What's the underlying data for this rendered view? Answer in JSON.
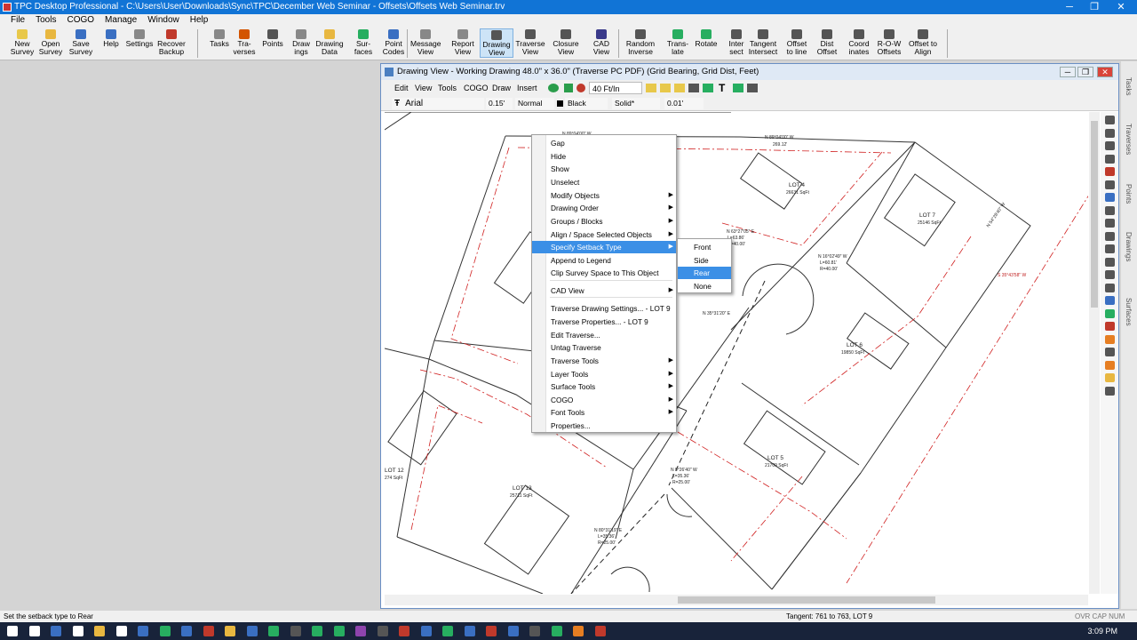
{
  "window": {
    "title": "TPC Desktop Professional - C:\\Users\\User\\Downloads\\Sync\\TPC\\December Web Seminar - Offsets\\Offsets Web Seminar.trv"
  },
  "menu": [
    "File",
    "Tools",
    "COGO",
    "Manage",
    "Window",
    "Help"
  ],
  "toolbar": [
    {
      "l1": "New",
      "l2": "Survey",
      "color": "#e8c84a"
    },
    {
      "l1": "Open",
      "l2": "Survey",
      "color": "#e8b740"
    },
    {
      "l1": "Save",
      "l2": "Survey",
      "color": "#3a6fc2"
    },
    {
      "l1": "Help",
      "l2": "",
      "color": "#3a6fc2"
    },
    {
      "l1": "Settings",
      "l2": "",
      "color": "#888888"
    },
    {
      "l1": "Recover",
      "l2": "Backup",
      "color": "#c0392b"
    },
    {
      "l1": "Tasks",
      "l2": "",
      "color": "#888888"
    },
    {
      "l1": "Tra-",
      "l2": "verses",
      "color": "#d35400"
    },
    {
      "l1": "Points",
      "l2": "",
      "color": "#555555"
    },
    {
      "l1": "Draw",
      "l2": "ings",
      "color": "#888888"
    },
    {
      "l1": "Drawing",
      "l2": "Data",
      "color": "#e8b740"
    },
    {
      "l1": "Sur-",
      "l2": "faces",
      "color": "#27ae60"
    },
    {
      "l1": "Point",
      "l2": "Codes",
      "color": "#3a6fc2"
    },
    {
      "l1": "Message",
      "l2": "View",
      "color": "#888888"
    },
    {
      "l1": "Report",
      "l2": "View",
      "color": "#888888"
    },
    {
      "l1": "Drawing",
      "l2": "View",
      "color": "#555555"
    },
    {
      "l1": "Traverse",
      "l2": "View",
      "color": "#555555"
    },
    {
      "l1": "Closure",
      "l2": "View",
      "color": "#555555"
    },
    {
      "l1": "CAD",
      "l2": "View",
      "color": "#3a3a8a"
    },
    {
      "l1": "Random",
      "l2": "Inverse",
      "color": "#555555"
    },
    {
      "l1": "Trans-",
      "l2": "late",
      "color": "#27ae60"
    },
    {
      "l1": "Rotate",
      "l2": "",
      "color": "#27ae60"
    },
    {
      "l1": "Inter",
      "l2": "sect",
      "color": "#555555"
    },
    {
      "l1": "Tangent",
      "l2": "Intersect",
      "color": "#555555"
    },
    {
      "l1": "Offset",
      "l2": "to line",
      "color": "#555555"
    },
    {
      "l1": "Dist",
      "l2": "Offset",
      "color": "#555555"
    },
    {
      "l1": "Coord",
      "l2": "inates",
      "color": "#555555"
    },
    {
      "l1": "R-O-W",
      "l2": "Offsets",
      "color": "#555555"
    },
    {
      "l1": "Offset to",
      "l2": "Align",
      "color": "#555555"
    }
  ],
  "drawing_window": {
    "title": "Drawing View - Working Drawing  48.0\" x 36.0\" (Traverse PC PDF) (Grid Bearing, Grid Dist, Feet)",
    "menu": [
      "Edit",
      "View",
      "Tools",
      "COGO",
      "Draw",
      "Insert"
    ],
    "scale": "40 Ft/In",
    "font": "Arial",
    "size": "0.15'",
    "style": "Normal",
    "color": "Black",
    "line": "Solid*",
    "weight": "0.01'"
  },
  "context_menu": [
    {
      "label": "Gap"
    },
    {
      "label": "Hide"
    },
    {
      "label": "Show"
    },
    {
      "label": "Unselect"
    },
    {
      "label": "Modify Objects",
      "sub": true
    },
    {
      "label": "Drawing Order",
      "sub": true
    },
    {
      "label": "Groups / Blocks",
      "sub": true
    },
    {
      "label": "Align / Space Selected Objects",
      "sub": true
    },
    {
      "label": "Specify Setback Type",
      "sub": true,
      "hl": true
    },
    {
      "label": "Append to Legend"
    },
    {
      "label": "Clip Survey Space to This Object"
    },
    {
      "label": "CAD View",
      "sub": true
    },
    {
      "label": "Traverse Drawing Settings... - LOT 9"
    },
    {
      "label": "Traverse Properties... - LOT 9"
    },
    {
      "label": "Edit Traverse..."
    },
    {
      "label": "Untag Traverse"
    },
    {
      "label": "Traverse Tools",
      "sub": true
    },
    {
      "label": "Layer Tools",
      "sub": true
    },
    {
      "label": "Surface Tools",
      "sub": true
    },
    {
      "label": "COGO",
      "sub": true
    },
    {
      "label": "Font Tools",
      "sub": true
    },
    {
      "label": "Properties..."
    }
  ],
  "submenu": [
    "Front",
    "Side",
    "Rear",
    "None"
  ],
  "submenu_selected": "Rear",
  "drawing_labels": {
    "lot4": "LOT 4",
    "lot4_area": "26631 SqFt",
    "lot7": "LOT 7",
    "lot7_area": "25146 SqFt",
    "lot6": "LOT 6",
    "lot6_area": "19850 SqFt",
    "lot5": "LOT 5",
    "lot5_area": "21709 SqFt",
    "lot13": "LOT 13",
    "lot13_area": "25711 SqFt",
    "lot12": "LOT 12",
    "lot12_area": "274 SqFt",
    "b1": "N 89°04'00\" W",
    "b2": "N 89°04'00\" W",
    "b3": "269.12'",
    "c1": "N 63°27'05\" E",
    "c2": "L=63.86'",
    "c3": "R=40.00'",
    "c4": "N 16°02'49\" W",
    "c5": "L=60.81'",
    "c6": "R=40.00'",
    "c7": "N 9°26'40\" W",
    "c8": "L=35.36'",
    "c9": "R=25.00'",
    "c10": "N 80°31'19\" E",
    "c11": "L=35.36'",
    "c12": "R=25.00'",
    "d1": "S 35°43'58\" W",
    "d2": "N 35°31'20\" E",
    "d3": "N 54°28'40\" W"
  },
  "status": {
    "left": "Set the setback type to Rear",
    "middle": "Tangent: 761 to 763, LOT 9",
    "right": "OVR CAP NUM"
  },
  "right_tabs": [
    "Tasks",
    "Traverses",
    "Points",
    "Drawings",
    "Surfaces"
  ],
  "taskbar": {
    "time": "3:09 PM"
  }
}
